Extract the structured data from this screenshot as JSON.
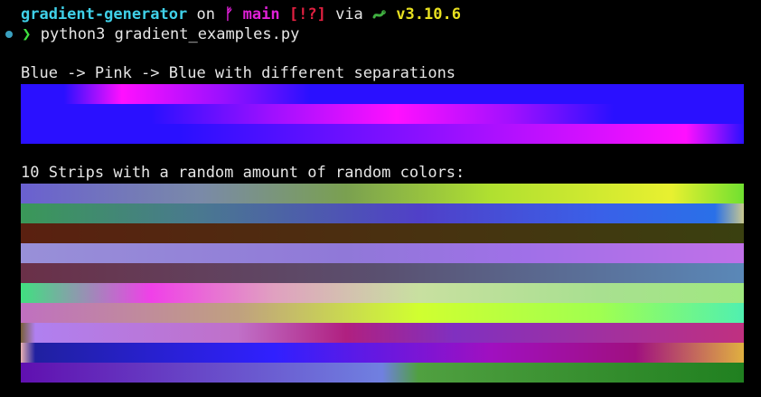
{
  "prompt": {
    "directory": "gradient-generator",
    "on_text": "on",
    "branch_icon": "git-branch-icon",
    "branch_glyph": "ᚠ",
    "branch": "main",
    "git_status": "[!?]",
    "via_text": "via",
    "python_icon": "python-snake-icon",
    "python_version": "v3.10.6"
  },
  "command": {
    "chevron": "❯",
    "text": "python3 gradient_examples.py"
  },
  "section1": {
    "title": "Blue -> Pink -> Blue with different separations",
    "strips": [
      {
        "stops": [
          "#2a10ff 0%",
          "#2a10ff 6%",
          "#ff10ff 14%",
          "#9a10ff 28%",
          "#2a10ff 40%",
          "#2a10ff 100%"
        ]
      },
      {
        "stops": [
          "#2a10ff 0%",
          "#2a10ff 18%",
          "#a010ff 35%",
          "#ff10ff 52%",
          "#a010ff 68%",
          "#2a10ff 82%",
          "#2a10ff 100%"
        ]
      },
      {
        "stops": [
          "#2a10ff 0%",
          "#2a10ff 22%",
          "#8a10ff 55%",
          "#ff10ff 92%",
          "#9a10ff 96%",
          "#2a10ff 100%"
        ]
      }
    ]
  },
  "section2": {
    "title": "10 Strips with a random amount of random colors:",
    "strips": [
      {
        "stops": [
          "#6a60d0 0%",
          "#7a8aa8 25%",
          "#7aa050 45%",
          "#b0e030 65%",
          "#e8f030 90%",
          "#70e030 100%"
        ]
      },
      {
        "stops": [
          "#3a9858 0%",
          "#4a7890 25%",
          "#5040c8 55%",
          "#3a60e8 80%",
          "#2a70e8 96%",
          "#c8c890 100%"
        ]
      },
      {
        "stops": [
          "#5a2010 0%",
          "#4a3010 50%",
          "#3a4010 100%"
        ]
      },
      {
        "stops": [
          "#9890d8 0%",
          "#9078d8 45%",
          "#a070e8 70%",
          "#c070e8 100%"
        ]
      },
      {
        "stops": [
          "#6a3048 0%",
          "#5a5070 50%",
          "#5a88b8 100%"
        ]
      },
      {
        "stops": [
          "#40e080 0%",
          "#f040e8 18%",
          "#e0a0c0 35%",
          "#c8e0a0 55%",
          "#a8e090 80%",
          "#a0e880 100%"
        ]
      },
      {
        "stops": [
          "#c070c0 0%",
          "#c0a080 30%",
          "#d0ff30 55%",
          "#a0ff50 80%",
          "#50f0b0 100%"
        ]
      },
      {
        "stops": [
          "#786038 0%",
          "#b080f0 2%",
          "#c070c8 30%",
          "#b02080 45%",
          "#8030c0 60%",
          "#c03080 100%"
        ]
      },
      {
        "stops": [
          "#e8b0b0 0%",
          "#2020a0 2%",
          "#3020ff 35%",
          "#a010c0 65%",
          "#a01080 85%",
          "#e0b040 100%"
        ]
      },
      {
        "stops": [
          "#6010b0 0%",
          "#7080e0 50%",
          "#50a040 55%",
          "#208020 100%"
        ]
      }
    ]
  }
}
